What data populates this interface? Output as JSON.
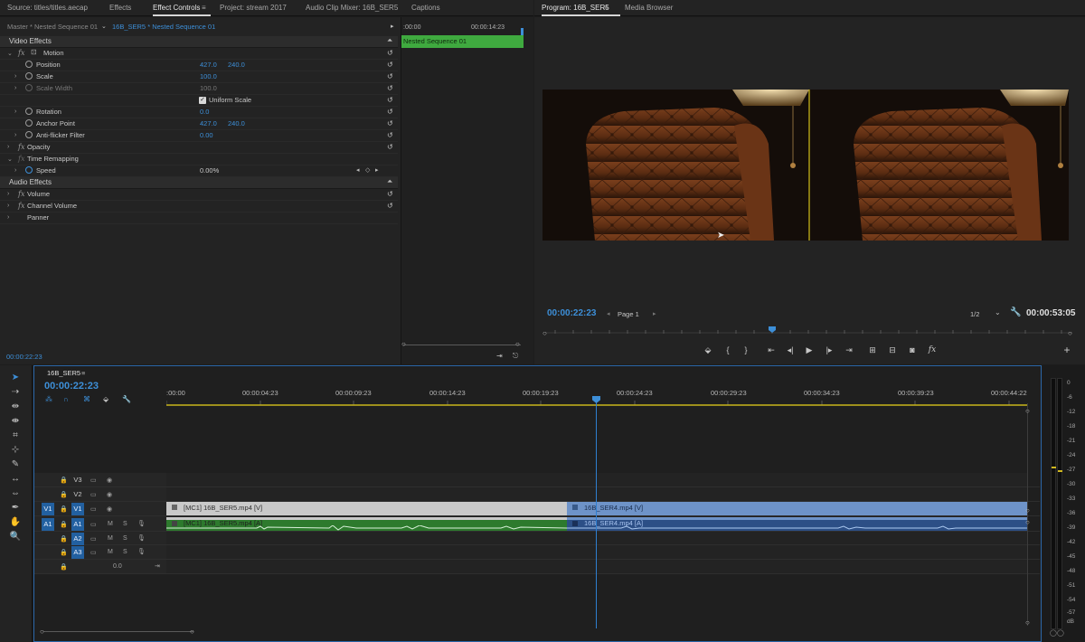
{
  "source_tabs": {
    "source": "Source: titles/titles.aecap",
    "effects": "Effects",
    "effect_controls": "Effect Controls",
    "project": "Project: stream 2017",
    "audio_mixer": "Audio Clip Mixer: 16B_SER5",
    "captions": "Captions"
  },
  "ec_header": {
    "master": "Master * Nested Sequence 01",
    "sequence": "16B_SER5 * Nested Sequence 01",
    "mini_time_start": ":00:00",
    "mini_time_mid": "00:00:14:23",
    "clip_name": "Nested Sequence 01"
  },
  "ec_sections": {
    "video_effects": "Video Effects",
    "audio_effects": "Audio Effects"
  },
  "ec_rows": {
    "motion": "Motion",
    "position": "Position",
    "position_x": "427.0",
    "position_y": "240.0",
    "scale": "Scale",
    "scale_val": "100.0",
    "scale_width": "Scale Width",
    "scale_width_val": "100.0",
    "uniform_scale": "Uniform Scale",
    "rotation": "Rotation",
    "rotation_val": "0.0",
    "anchor_point": "Anchor Point",
    "anchor_x": "427.0",
    "anchor_y": "240.0",
    "anti_flicker": "Anti-flicker Filter",
    "anti_flicker_val": "0.00",
    "opacity": "Opacity",
    "time_remapping": "Time Remapping",
    "speed": "Speed",
    "speed_val": "0.00%",
    "volume": "Volume",
    "channel_volume": "Channel Volume",
    "panner": "Panner"
  },
  "ec_footer_time": "00:00:22:23",
  "program": {
    "tab_program": "Program: 16B_SER5",
    "tab_media": "Media Browser",
    "timecode": "00:00:22:23",
    "page": "Page 1",
    "resolution": "1/2",
    "duration": "00:00:53:05"
  },
  "timeline": {
    "tab": "16B_SER5",
    "timecode": "00:00:22:23",
    "ticks": [
      ":00:00",
      "00:00:04:23",
      "00:00:09:23",
      "00:00:14:23",
      "00:00:19:23",
      "00:00:24:23",
      "00:00:29:23",
      "00:00:34:23",
      "00:00:39:23",
      "00:00:44:22"
    ],
    "tracks": {
      "v3": "V3",
      "v2": "V2",
      "v1_src": "V1",
      "v1": "V1",
      "a1_src": "A1",
      "a1": "A1",
      "a2": "A2",
      "a3": "A3",
      "m": "M",
      "s": "S",
      "master_val": "0.0"
    },
    "clips": {
      "v1_a": "[MC1] 16B_SER5.mp4 [V]",
      "v1_b": "16B_SER4.mp4 [V]",
      "a1_a": "[MC1] 16B_SER5.mp4 [A]",
      "a1_b": "16B_SER4.mp4 [A]"
    }
  },
  "meter": {
    "labels": [
      "0",
      "-6",
      "-12",
      "-18",
      "-21",
      "-24",
      "-27",
      "-30",
      "-33",
      "-36",
      "-39",
      "-42",
      "-45",
      "-48",
      "-51",
      "-54",
      "-57",
      "dB"
    ]
  },
  "colors": {
    "accent": "#3d8fd8",
    "video_clip": "#6e93c8",
    "video_clip_nested": "#c9c9c9",
    "audio_clip": "#2d7a2d",
    "ec_clip": "#3faa3f",
    "playhead": "#2f7fd0"
  }
}
